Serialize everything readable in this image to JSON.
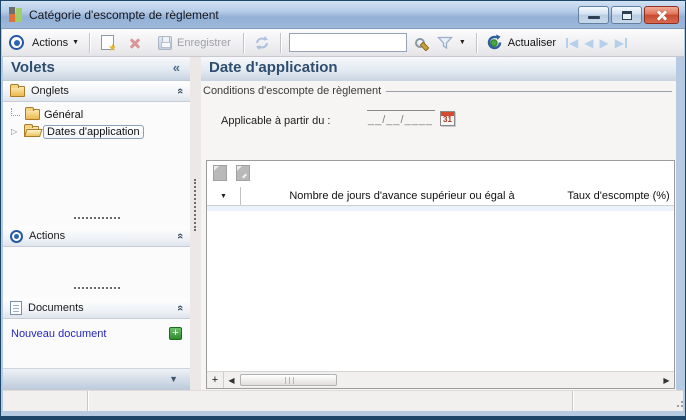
{
  "window": {
    "title": "Catégorie d'escompte de règlement"
  },
  "toolbar": {
    "actions_label": "Actions",
    "save_label": "Enregistrer",
    "search_value": "",
    "refresh_label": "Actualiser"
  },
  "sidebar": {
    "title": "Volets",
    "sections": {
      "onglets_label": "Onglets",
      "actions_label": "Actions",
      "documents_label": "Documents"
    },
    "tree": [
      {
        "label": "Général"
      },
      {
        "label": "Dates d'application"
      }
    ],
    "new_document_label": "Nouveau document"
  },
  "main": {
    "title": "Date d'application",
    "group_label": "Conditions d'escompte de règlement",
    "date_field": {
      "label": "Applicable à partir du :",
      "value": "__/__/____",
      "calendar_day": "31"
    },
    "table": {
      "columns": [
        "Nombre de jours d'avance supérieur ou égal à",
        "Taux d'escompte (%)"
      ],
      "rows": []
    }
  },
  "statusbar": {
    "cells": [
      "",
      "",
      ""
    ]
  },
  "icons": {
    "caret_down": "▼",
    "collapse_sidebar": "«",
    "collapse_section": "«",
    "tree_expander": "▷",
    "nav_prev": "◀",
    "nav_next": "▶",
    "scroll_left": "◀",
    "scroll_right": "▶",
    "plus": "+",
    "sidebar_more": "▼"
  },
  "colors": {
    "titlebar_top": "#d2e1f3",
    "titlebar_bottom": "#93b0d6",
    "header_text": "#2f4d6e",
    "accent_blue": "#2a62b0",
    "link_blue": "#2626bb",
    "plus_green": "#3d9b3d",
    "close_red": "#c94a30",
    "selected_border": "#8aa0b8"
  }
}
